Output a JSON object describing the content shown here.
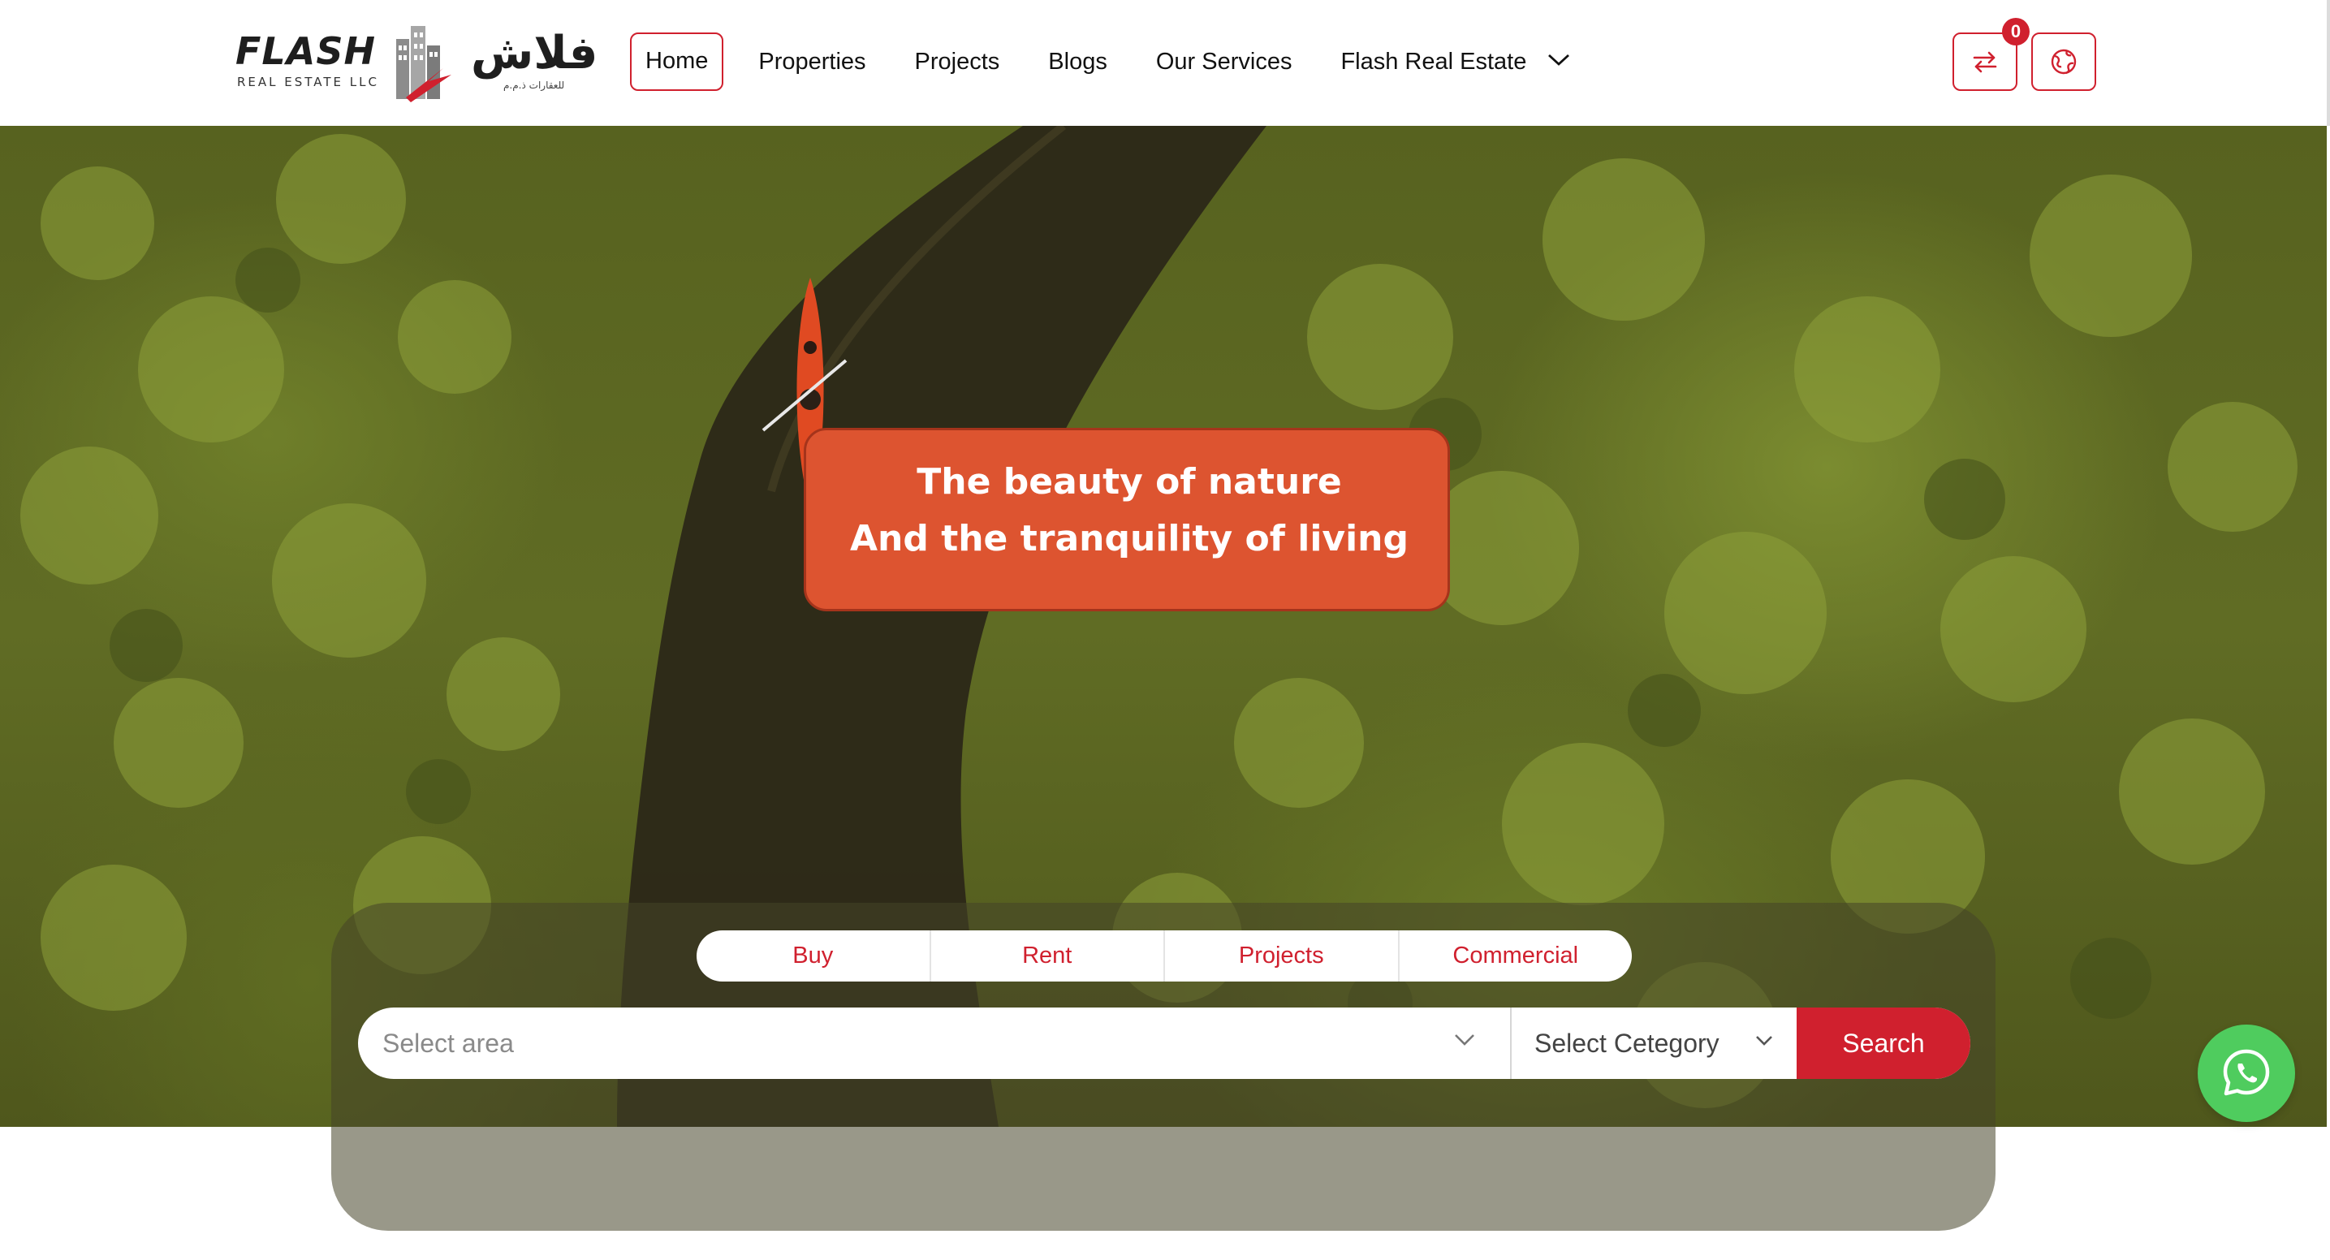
{
  "brand": {
    "logo_en": "FLASH",
    "logo_en_sub": "REAL ESTATE LLC",
    "logo_ar": "فلاش",
    "logo_ar_sub": "للعقارات ذ.م.م",
    "accent_color": "#d0202e"
  },
  "nav": {
    "items": [
      {
        "label": "Home",
        "active": true
      },
      {
        "label": "Properties"
      },
      {
        "label": "Projects"
      },
      {
        "label": "Blogs"
      },
      {
        "label": "Our Services"
      },
      {
        "label": "Flash Real Estate",
        "icon": "chevron-down-icon"
      }
    ]
  },
  "header_actions": {
    "compare_icon": "compare-arrows-icon",
    "compare_count": "0",
    "language_icon": "globe-icon"
  },
  "hero": {
    "line1": "The beauty of nature",
    "line2": "And the tranquility of living"
  },
  "search": {
    "tabs": [
      "Buy",
      "Rent",
      "Projects",
      "Commercial"
    ],
    "area_placeholder": "Select area",
    "category_label": "Select Cetegory",
    "button_label": "Search"
  },
  "whatsapp": {
    "icon": "whatsapp-icon",
    "color": "#4fcc5e"
  }
}
